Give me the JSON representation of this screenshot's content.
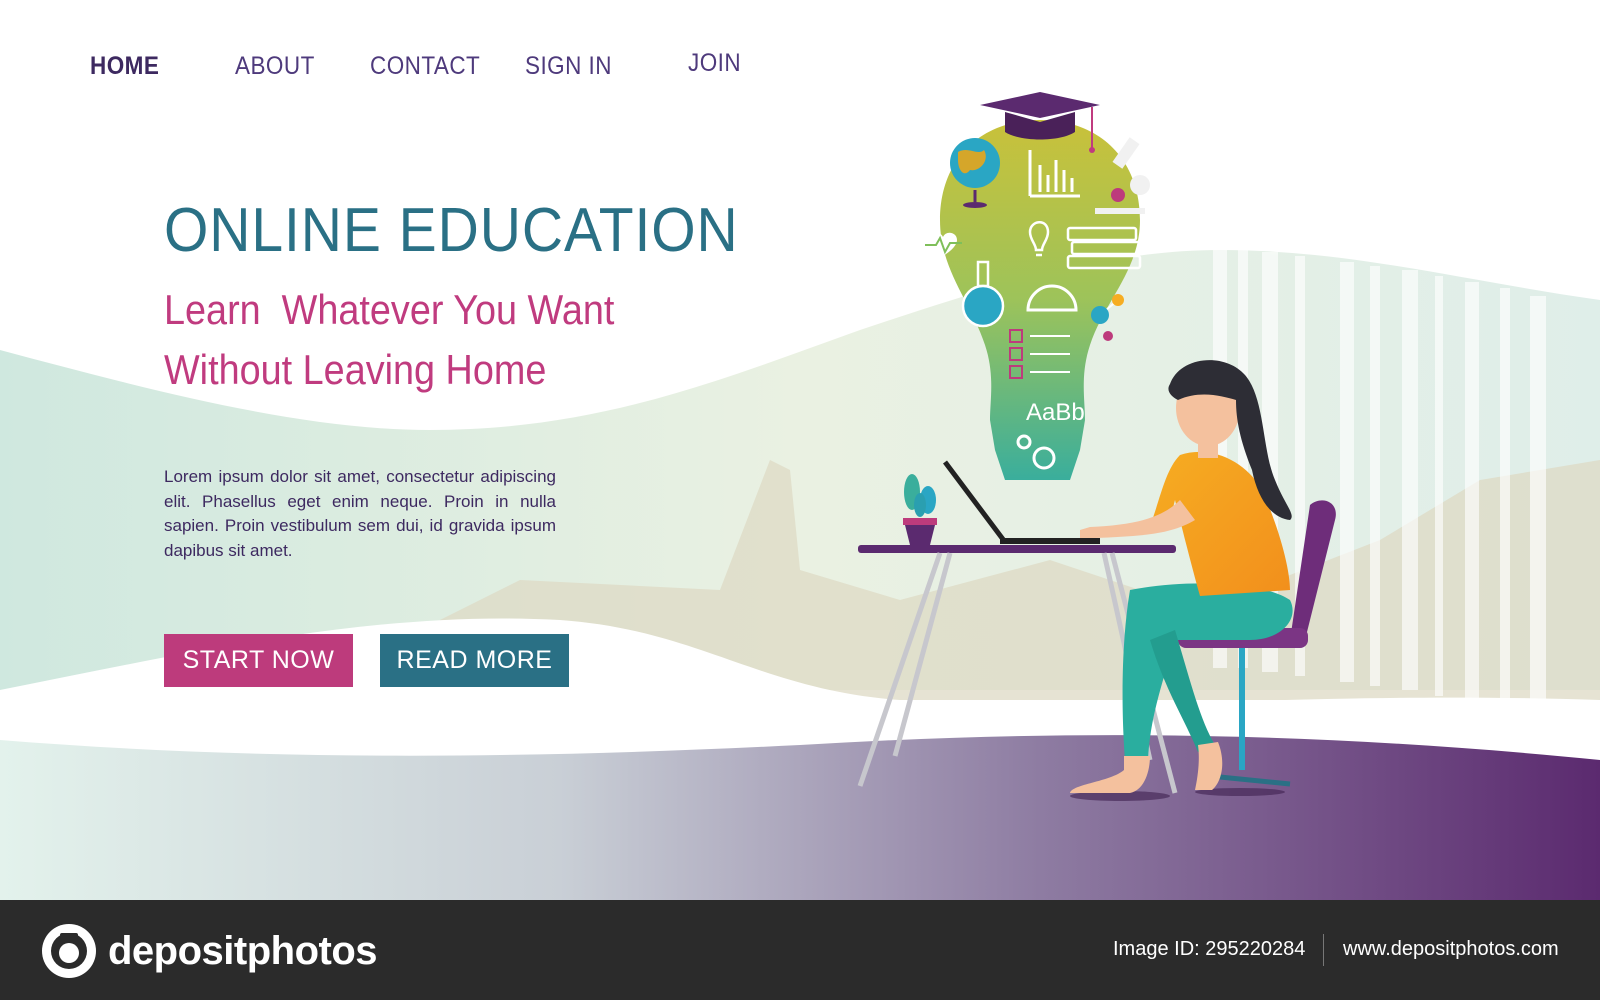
{
  "nav": {
    "items": [
      {
        "label": "HOME",
        "active": true
      },
      {
        "label": "ABOUT",
        "active": false
      },
      {
        "label": "CONTACT",
        "active": false
      },
      {
        "label": "SIGN IN",
        "active": false
      },
      {
        "label": "JOIN",
        "active": false
      }
    ]
  },
  "hero": {
    "title": "ONLINE EDUCATION",
    "subtitle": "Learn  Whatever You Want\nWithout Leaving Home",
    "body": "Lorem ipsum dolor sit amet, consectetur adipiscing elit. Phasellus eget enim neque. Proin in nulla sapien. Proin vestibulum sem dui, id gravida ipsum dapibus sit amet.",
    "start_label": "START NOW",
    "read_label": "READ MORE"
  },
  "illustration": {
    "bulb_text": "AaBb"
  },
  "footer": {
    "brand": "depositphotos",
    "image_id": "Image ID: 295220284",
    "url": "www.depositphotos.com"
  },
  "colors": {
    "primary_teal": "#2a7085",
    "primary_pink": "#bd3b7c",
    "nav_purple": "#4e3a7c",
    "floor_purple": "#5e2a6e",
    "footer_bg": "#2b2b2b"
  }
}
